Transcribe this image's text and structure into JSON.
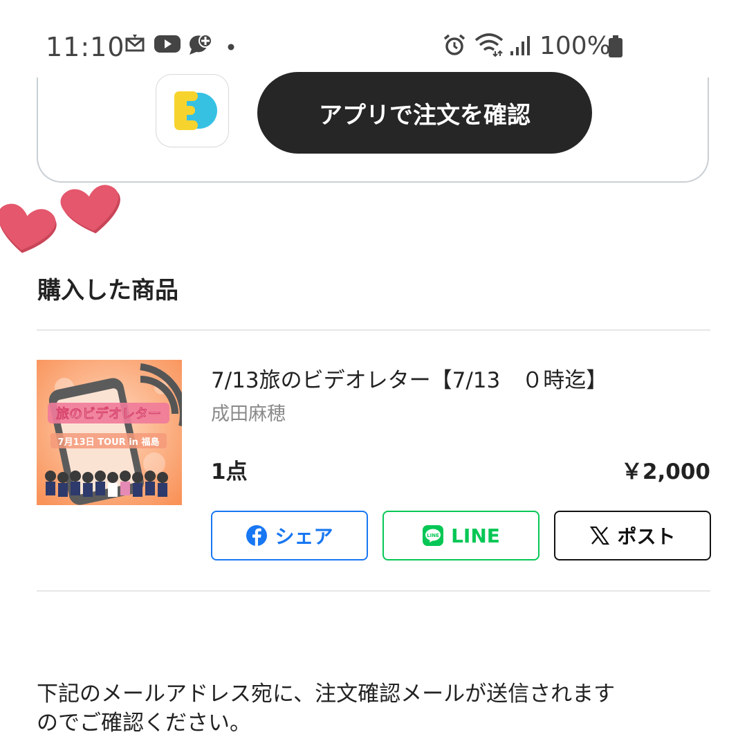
{
  "status_bar": {
    "time": "11:10",
    "battery": "100%",
    "icons": [
      "mail-icon",
      "youtube-icon",
      "chat-plus-icon",
      "dot-icon",
      "alarm-icon",
      "wifi-icon",
      "signal-icon",
      "battery-icon"
    ]
  },
  "app_card": {
    "app_icon": "app-logo-icon",
    "confirm_button": "アプリで注文を確認"
  },
  "purchased": {
    "section_title": "購入した商品",
    "item": {
      "thumbnail_title": "旅のビデオレター",
      "thumbnail_subtitle": "7月13日 TOUR in 福島",
      "title": "7/13旅のビデオレター【7/13　０時迄】",
      "artist": "成田麻穂",
      "quantity": "1点",
      "price": "￥2,000"
    },
    "share": {
      "facebook": "シェア",
      "line": "LINE",
      "x": "ポスト"
    }
  },
  "notice": {
    "line1": "下記のメールアドレス宛に、注文確認メールが送信されます",
    "line2": "のでご確認ください。"
  },
  "colors": {
    "facebook": "#1877f2",
    "line": "#06c755",
    "heart": "#e4576c",
    "button_dark": "#262626"
  }
}
